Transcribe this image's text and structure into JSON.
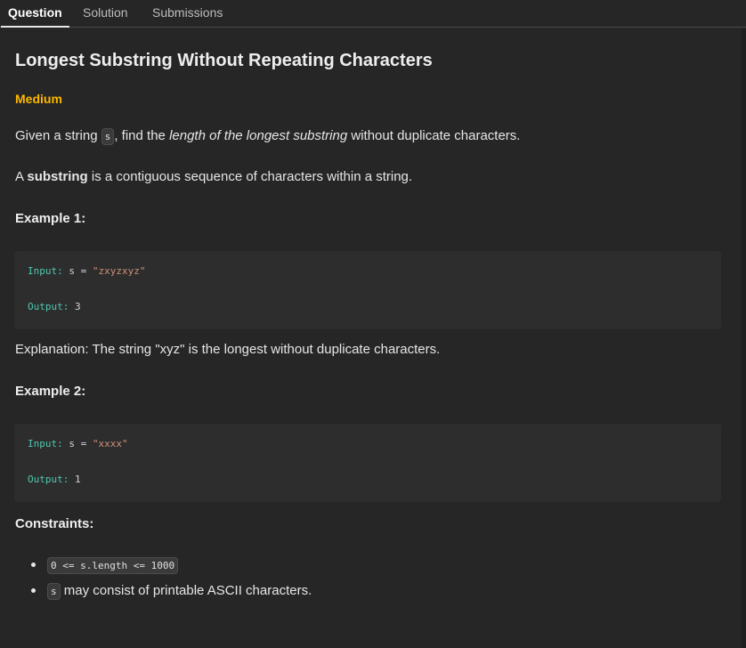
{
  "tabs": [
    {
      "label": "Question",
      "active": true
    },
    {
      "label": "Solution",
      "active": false
    },
    {
      "label": "Submissions",
      "active": false
    }
  ],
  "problem": {
    "title": "Longest Substring Without Repeating Characters",
    "difficulty": "Medium",
    "difficulty_color": "#ffb800",
    "statement": {
      "p1_a": "Given a string ",
      "p1_code": "s",
      "p1_b": ", find the ",
      "p1_em": "length of the longest substring",
      "p1_c": " without duplicate characters.",
      "p2_a": "A ",
      "p2_bold": "substring",
      "p2_b": " is a contiguous sequence of characters within a string."
    },
    "examples": [
      {
        "heading": "Example 1:",
        "input_label": "Input:",
        "input_var": " s = ",
        "input_value": "\"zxyzxyz\"",
        "output_label": "Output:",
        "output_value": " 3",
        "explanation": "Explanation: The string \"xyz\" is the longest without duplicate characters."
      },
      {
        "heading": "Example 2:",
        "input_label": "Input:",
        "input_var": " s = ",
        "input_value": "\"xxxx\"",
        "output_label": "Output:",
        "output_value": " 1"
      }
    ],
    "constraints": {
      "heading": "Constraints:",
      "item1_code": "0 <= s.length <= 1000",
      "item2_code": "s",
      "item2_text": " may consist of printable ASCII characters."
    }
  }
}
